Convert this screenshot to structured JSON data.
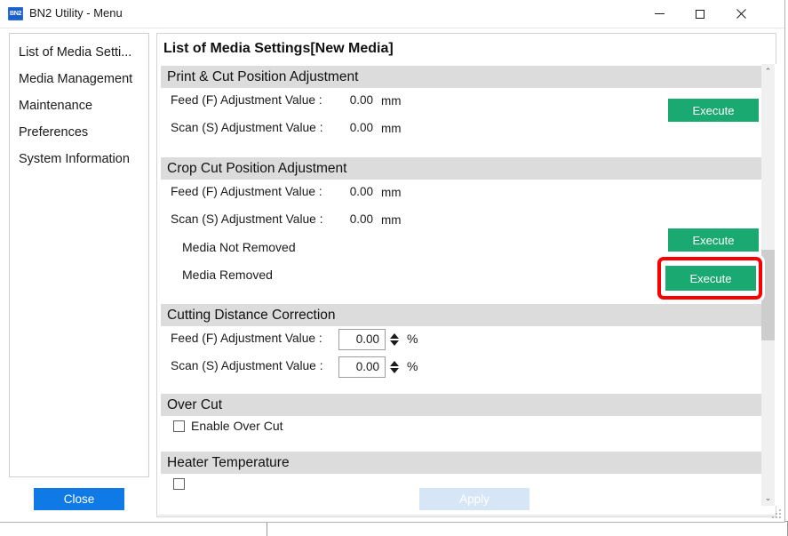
{
  "window": {
    "title": "BN2 Utility - Menu",
    "icon_label": "BN2",
    "icon_name": "bn2-app-icon",
    "minimize_label": "Minimize",
    "maximize_label": "Maximize",
    "close_label": "Close"
  },
  "sidebar": {
    "items": [
      {
        "label": "List of Media Setti..."
      },
      {
        "label": "Media Management"
      },
      {
        "label": "Maintenance"
      },
      {
        "label": "Preferences"
      },
      {
        "label": "System Information"
      }
    ]
  },
  "buttons": {
    "close": "Close",
    "apply": "Apply",
    "execute": "Execute"
  },
  "panel": {
    "title": "List of Media Settings[New Media]",
    "groups": [
      {
        "header": "Print & Cut Position Adjustment",
        "rows": [
          {
            "label": "Feed (F) Adjustment Value :",
            "value": "0.00",
            "unit": "mm"
          },
          {
            "label": "Scan (S) Adjustment Value :",
            "value": "0.00",
            "unit": "mm"
          }
        ],
        "execute_label": "Execute"
      },
      {
        "header": "Crop Cut Position Adjustment",
        "rows": [
          {
            "label": "Feed (F) Adjustment Value :",
            "value": "0.00",
            "unit": "mm"
          },
          {
            "label": "Scan (S) Adjustment Value :",
            "value": "0.00",
            "unit": "mm"
          },
          {
            "label": "Media Not Removed",
            "value": "",
            "unit": ""
          },
          {
            "label": "Media Removed",
            "value": "",
            "unit": ""
          }
        ],
        "execute_label_1": "Execute",
        "execute_label_2": "Execute"
      },
      {
        "header": "Cutting Distance Correction",
        "rows": [
          {
            "label": "Feed (F) Adjustment Value :",
            "value": "0.00",
            "unit": "%"
          },
          {
            "label": "Scan (S) Adjustment Value :",
            "value": "0.00",
            "unit": "%"
          }
        ]
      },
      {
        "header": "Over Cut",
        "checkbox_label": "Enable Over Cut",
        "checked": false
      },
      {
        "header": "Heater Temperature"
      }
    ]
  },
  "scrollbar": {
    "up_arrow": "⌃",
    "down_arrow": "⌄"
  },
  "highlight": {
    "target": "Execute",
    "color": "#fb0000"
  },
  "colors": {
    "execute_green": "#1aa970",
    "close_blue": "#0f7ae5",
    "apply_disabled": "#d6e6f7",
    "group_header_gray": "#dcdcdc",
    "highlight_red": "#fb0000"
  }
}
